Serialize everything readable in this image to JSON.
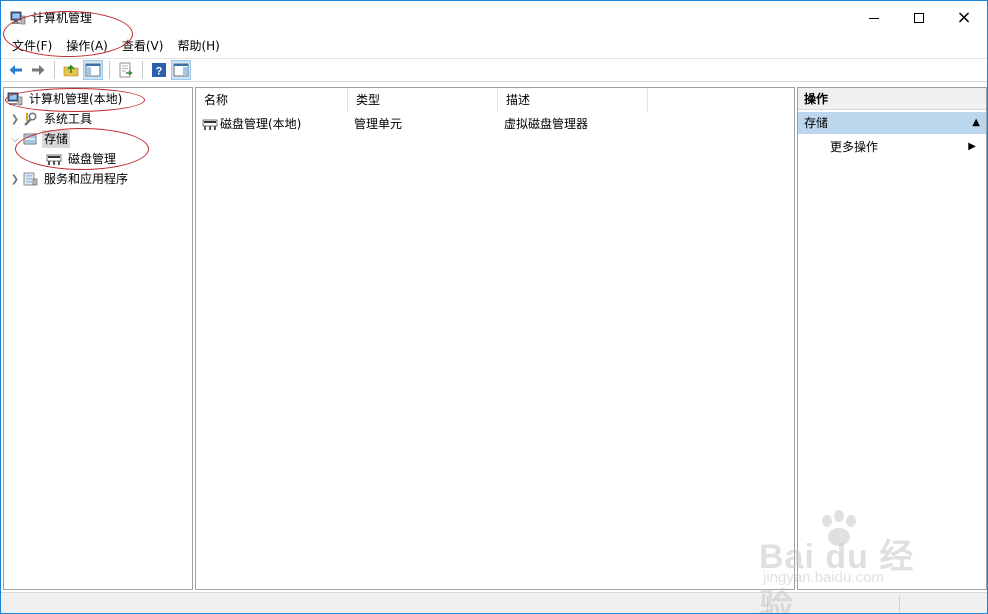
{
  "window": {
    "title": "计算机管理",
    "controls": {
      "minimize": "minimize",
      "maximize": "maximize",
      "close": "×"
    }
  },
  "menubar": {
    "items": [
      {
        "label": "文件(F)"
      },
      {
        "label": "操作(A)"
      },
      {
        "label": "查看(V)"
      },
      {
        "label": "帮助(H)"
      }
    ]
  },
  "toolbar": {
    "icons": [
      "back-icon",
      "forward-icon",
      "up-folder-icon",
      "show-hide-tree-icon",
      "export-list-icon",
      "help-icon",
      "show-hide-action-pane-icon"
    ]
  },
  "tree": {
    "root": "计算机管理(本地)",
    "items": [
      {
        "label": "系统工具",
        "expanded": false
      },
      {
        "label": "存储",
        "expanded": true,
        "selected": true
      },
      {
        "label": "磁盘管理",
        "child": true
      },
      {
        "label": "服务和应用程序",
        "expanded": false
      }
    ]
  },
  "list": {
    "columns": [
      "名称",
      "类型",
      "描述"
    ],
    "rows": [
      {
        "name": "磁盘管理(本地)",
        "type": "管理单元",
        "desc": "虚拟磁盘管理器"
      }
    ]
  },
  "actions": {
    "title": "操作",
    "section": "存储",
    "items": [
      {
        "label": "更多操作"
      }
    ]
  },
  "watermark": {
    "brand": "Bai du 经验",
    "url": "jingyan.baidu.com"
  },
  "colors": {
    "accent_border": "#1883d7",
    "annotation": "#c0282b",
    "selection": "#d9d9d9",
    "action_section": "#bcd6ee"
  }
}
